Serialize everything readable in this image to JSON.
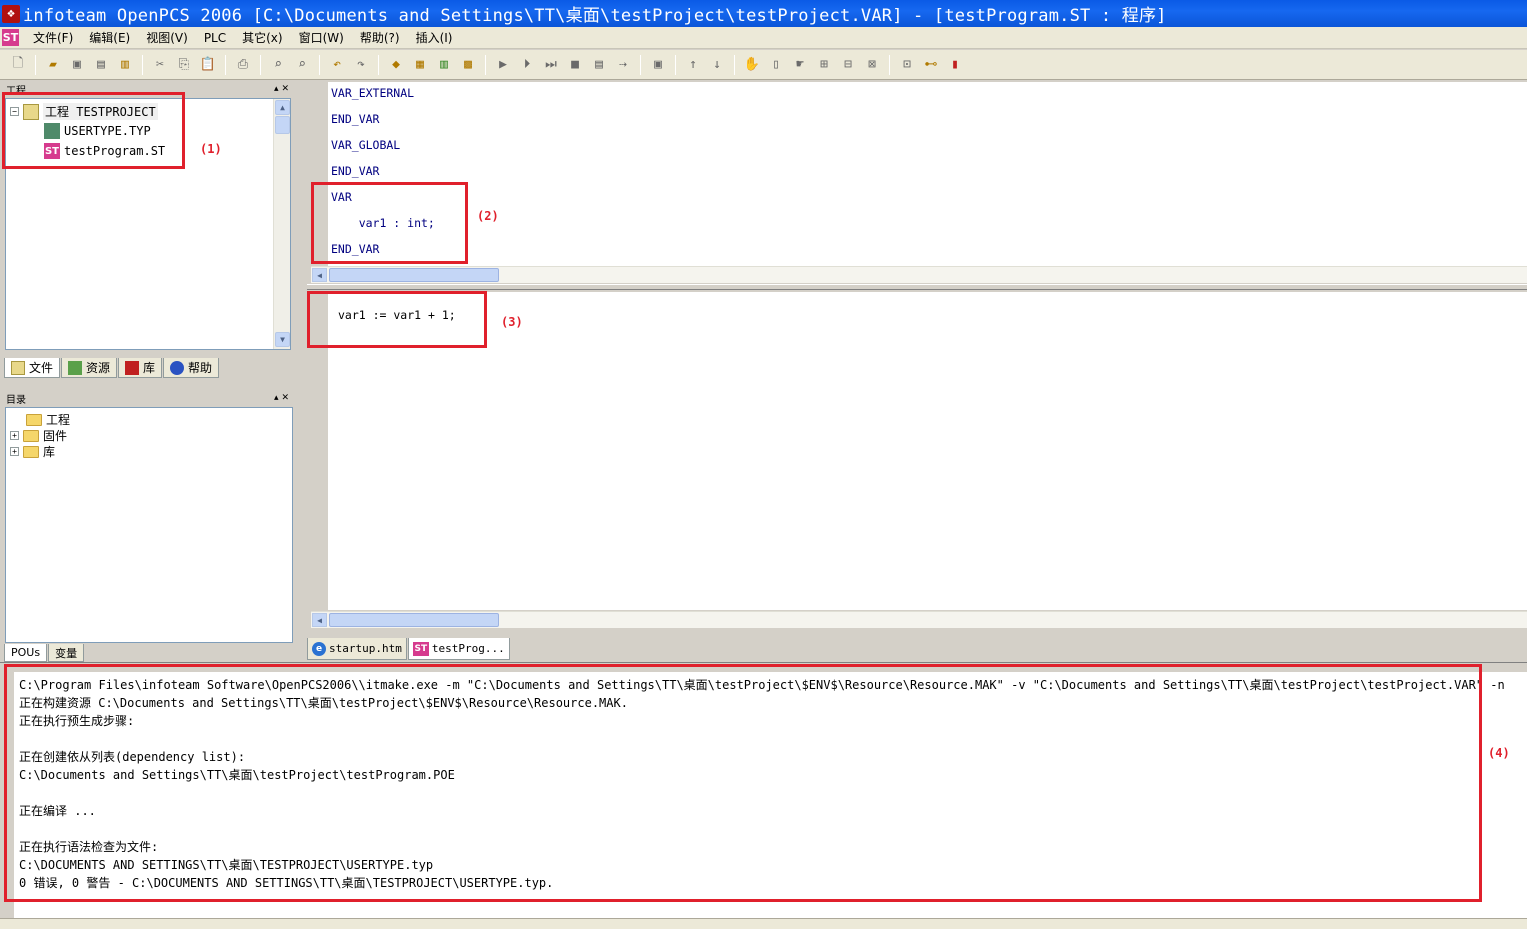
{
  "window": {
    "title": "infoteam OpenPCS 2006 [C:\\Documents and Settings\\TT\\桌面\\testProject\\testProject.VAR]  - [testProgram.ST : 程序]"
  },
  "menu": {
    "items": [
      "文件(F)",
      "编辑(E)",
      "视图(V)",
      "PLC",
      "其它(x)",
      "窗口(W)",
      "帮助(?)",
      "插入(I)"
    ]
  },
  "project_panel": {
    "header": "工程",
    "tree": {
      "root": "工程  TESTPROJECT",
      "children": [
        "USERTYPE.TYP",
        "testProgram.ST"
      ]
    },
    "tabs": [
      "文件",
      "资源",
      "库",
      "帮助"
    ]
  },
  "catalog_panel": {
    "header": "目录",
    "items": [
      "工程",
      "固件",
      "库"
    ],
    "tabs": [
      "POUs",
      "变量"
    ]
  },
  "declaration_editor": {
    "lines": [
      "VAR_EXTERNAL",
      "END_VAR",
      "VAR_GLOBAL",
      "END_VAR",
      "VAR",
      "    var1 : int;",
      "END_VAR"
    ]
  },
  "body_editor": {
    "lines": [
      "var1 := var1 + 1;"
    ]
  },
  "document_tabs": [
    "startup.htm",
    "testProg..."
  ],
  "output": {
    "lines": [
      "C:\\Program Files\\infoteam Software\\OpenPCS2006\\\\itmake.exe -m \"C:\\Documents and Settings\\TT\\桌面\\testProject\\$ENV$\\Resource\\Resource.MAK\" -v \"C:\\Documents and Settings\\TT\\桌面\\testProject\\testProject.VAR\" -n",
      "正在构建资源 C:\\Documents and Settings\\TT\\桌面\\testProject\\$ENV$\\Resource\\Resource.MAK.",
      "正在执行预生成步骤:",
      "",
      "正在创建依从列表(dependency list):",
      "C:\\Documents and Settings\\TT\\桌面\\testProject\\testProgram.POE",
      "",
      "正在编译 ...",
      "",
      "正在执行语法检查为文件:",
      "C:\\DOCUMENTS AND SETTINGS\\TT\\桌面\\TESTPROJECT\\USERTYPE.typ",
      "0 错误, 0 警告 - C:\\DOCUMENTS AND SETTINGS\\TT\\桌面\\TESTPROJECT\\USERTYPE.typ."
    ]
  },
  "annotations": [
    "(1)",
    "(2)",
    "(3)",
    "(4)"
  ],
  "colors": {
    "highlight_box": "#e0202c",
    "code_text": "#000080",
    "title_bar": "#0a5ae6"
  }
}
